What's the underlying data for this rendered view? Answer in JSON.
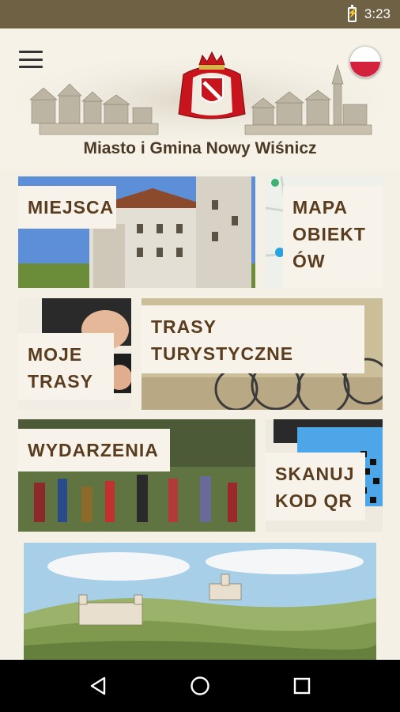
{
  "status": {
    "time": "3:23"
  },
  "header": {
    "title": "Miasto i Gmina Nowy Wiśnicz",
    "menu_icon": "hamburger-icon",
    "language_flag": "polish-flag-icon"
  },
  "tiles": {
    "miejsca": {
      "label": "MIEJSCA"
    },
    "mapa": {
      "label_lines": [
        "MAPA",
        "OBIEKT",
        "ÓW"
      ]
    },
    "moje_trasy": {
      "label_lines": [
        "MOJE",
        "TRASY"
      ]
    },
    "trasy_turystyczne": {
      "label_lines": [
        "TRASY",
        "TURYSTYCZNE"
      ]
    },
    "wydarzenia": {
      "label": "WYDARZENIA"
    },
    "skanuj": {
      "label_lines": [
        "SKANUJ",
        "KOD QR"
      ]
    }
  },
  "colors": {
    "status_bar": "#6f6143",
    "background": "#f4f0e6",
    "label_text": "#5a3c1e",
    "label_bg": "#f7f3ea",
    "flag_red": "#d4213d"
  },
  "nav": {
    "back": "back-icon",
    "home": "home-icon",
    "recents": "recents-icon"
  }
}
